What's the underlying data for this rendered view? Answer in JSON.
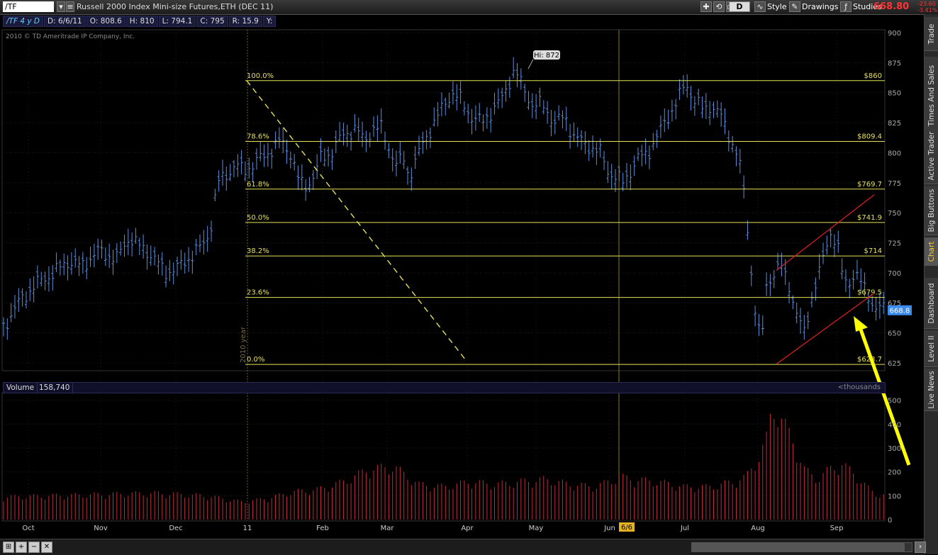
{
  "toolbar": {
    "symbol": "/TF",
    "title": "Russell 2000 Index Mini-size Futures,ETH (DEC 11)",
    "aggregation": "D",
    "style_label": "Style",
    "drawings_label": "Drawings",
    "studies_label": "Studies",
    "last_price": "668.80",
    "change": "-23.60",
    "change_pct": "-3.41%"
  },
  "sidebar_tabs": [
    "Trade",
    "Times And Sales",
    "Active Trader",
    "Big Buttons",
    "Chart",
    "Dashboard",
    "Level II",
    "Live News"
  ],
  "active_tab": "Chart",
  "info": {
    "symbol_period": "/TF 4 y D",
    "date": "D: 6/6/11",
    "open": "O: 808.6",
    "high": "H: 810",
    "low": "L: 794.1",
    "close": "C: 795",
    "range": "R: 15.9",
    "y": "Y:"
  },
  "copyright": "2010 © TD Ameritrade IP Company, Inc.",
  "volume_bar": {
    "label": "Volume",
    "value": "158,740",
    "units": "<thousands"
  },
  "colors": {
    "price_bars": "#5a8fe0",
    "volume_bars": "#c62a3a",
    "fib_lines": "#e6e05a",
    "channel": "#e02020",
    "arrow": "#ffff00",
    "last_price_tag": "#3c8cf0",
    "accent_red": "#ff3333"
  },
  "chart_data": {
    "type": "bar",
    "instrument": "/TF",
    "x": [
      "Oct",
      "Nov",
      "Dec",
      "11",
      "Feb",
      "Mar",
      "Apr",
      "May",
      "Jun",
      "Jul",
      "Aug",
      "Sep"
    ],
    "price_axis": {
      "ylim": [
        622,
        900
      ],
      "ticks": [
        900,
        875,
        850,
        825,
        800,
        775,
        750,
        725,
        700,
        675,
        650,
        625
      ]
    },
    "volume_axis": {
      "ylim": [
        0,
        520
      ],
      "ticks": [
        500,
        400,
        300,
        200,
        100,
        0
      ]
    },
    "year_marker": "2010 year",
    "cursor_date": "6/6",
    "high_label": "Hi: 872",
    "last_price_label": "668.8",
    "fibonacci": [
      {
        "pct": "100.0%",
        "price": "$860",
        "value": 860
      },
      {
        "pct": "78.6%",
        "price": "$809.4",
        "value": 809.4
      },
      {
        "pct": "61.8%",
        "price": "$769.7",
        "value": 769.7
      },
      {
        "pct": "50.0%",
        "price": "$741.9",
        "value": 741.9
      },
      {
        "pct": "38.2%",
        "price": "$714",
        "value": 714
      },
      {
        "pct": "23.6%",
        "price": "$679.5",
        "value": 679.5
      },
      {
        "pct": "0.0%",
        "price": "$623.7",
        "value": 623.7
      }
    ],
    "price_path": [
      [
        0,
        655
      ],
      [
        12,
        675
      ],
      [
        25,
        690
      ],
      [
        40,
        700
      ],
      [
        52,
        710
      ],
      [
        62,
        705
      ],
      [
        75,
        718
      ],
      [
        90,
        712
      ],
      [
        100,
        730
      ],
      [
        110,
        720
      ],
      [
        118,
        715
      ],
      [
        128,
        700
      ],
      [
        140,
        705
      ],
      [
        150,
        715
      ],
      [
        160,
        725
      ],
      [
        165,
        740
      ],
      [
        170,
        775
      ],
      [
        175,
        780
      ],
      [
        180,
        785
      ],
      [
        185,
        790
      ],
      [
        190,
        785
      ],
      [
        198,
        790
      ],
      [
        210,
        800
      ],
      [
        220,
        810
      ],
      [
        228,
        800
      ],
      [
        235,
        775
      ],
      [
        240,
        772
      ],
      [
        246,
        780
      ],
      [
        252,
        795
      ],
      [
        260,
        800
      ],
      [
        270,
        815
      ],
      [
        280,
        820
      ],
      [
        286,
        810
      ],
      [
        294,
        820
      ],
      [
        300,
        820
      ],
      [
        306,
        805
      ],
      [
        312,
        790
      ],
      [
        318,
        795
      ],
      [
        322,
        780
      ],
      [
        328,
        795
      ],
      [
        334,
        810
      ],
      [
        342,
        825
      ],
      [
        350,
        840
      ],
      [
        356,
        850
      ],
      [
        362,
        845
      ],
      [
        372,
        830
      ],
      [
        380,
        825
      ],
      [
        388,
        835
      ],
      [
        396,
        845
      ],
      [
        402,
        860
      ],
      [
        406,
        870
      ],
      [
        412,
        855
      ],
      [
        420,
        840
      ],
      [
        428,
        840
      ],
      [
        438,
        825
      ],
      [
        446,
        830
      ],
      [
        452,
        815
      ],
      [
        458,
        810
      ],
      [
        466,
        805
      ],
      [
        474,
        800
      ],
      [
        480,
        785
      ],
      [
        486,
        780
      ],
      [
        492,
        775
      ],
      [
        498,
        785
      ],
      [
        504,
        795
      ],
      [
        512,
        800
      ],
      [
        520,
        815
      ],
      [
        528,
        830
      ],
      [
        536,
        845
      ],
      [
        542,
        858
      ],
      [
        548,
        845
      ],
      [
        556,
        835
      ],
      [
        562,
        840
      ],
      [
        570,
        830
      ],
      [
        576,
        815
      ],
      [
        582,
        800
      ],
      [
        586,
        785
      ],
      [
        590,
        750
      ],
      [
        594,
        700
      ],
      [
        598,
        660
      ],
      [
        602,
        640
      ],
      [
        606,
        690
      ],
      [
        612,
        700
      ],
      [
        618,
        705
      ],
      [
        624,
        690
      ],
      [
        630,
        665
      ],
      [
        636,
        650
      ],
      [
        642,
        680
      ],
      [
        648,
        700
      ],
      [
        652,
        715
      ],
      [
        656,
        735
      ],
      [
        662,
        725
      ],
      [
        666,
        700
      ],
      [
        670,
        690
      ],
      [
        676,
        700
      ],
      [
        682,
        690
      ],
      [
        688,
        680
      ],
      [
        692,
        670
      ]
    ],
    "volume_path": [
      [
        0,
        90
      ],
      [
        40,
        95
      ],
      [
        80,
        100
      ],
      [
        120,
        105
      ],
      [
        160,
        95
      ],
      [
        190,
        70
      ],
      [
        210,
        85
      ],
      [
        230,
        110
      ],
      [
        250,
        120
      ],
      [
        270,
        150
      ],
      [
        290,
        200
      ],
      [
        310,
        210
      ],
      [
        330,
        140
      ],
      [
        350,
        130
      ],
      [
        370,
        150
      ],
      [
        390,
        140
      ],
      [
        410,
        150
      ],
      [
        430,
        160
      ],
      [
        450,
        140
      ],
      [
        470,
        130
      ],
      [
        490,
        170
      ],
      [
        500,
        160
      ],
      [
        520,
        150
      ],
      [
        540,
        130
      ],
      [
        560,
        130
      ],
      [
        580,
        150
      ],
      [
        590,
        170
      ],
      [
        600,
        250
      ],
      [
        606,
        320
      ],
      [
        610,
        430
      ],
      [
        614,
        440
      ],
      [
        620,
        380
      ],
      [
        628,
        300
      ],
      [
        636,
        200
      ],
      [
        646,
        160
      ],
      [
        656,
        200
      ],
      [
        666,
        220
      ],
      [
        676,
        180
      ],
      [
        684,
        140
      ],
      [
        692,
        100
      ]
    ]
  }
}
